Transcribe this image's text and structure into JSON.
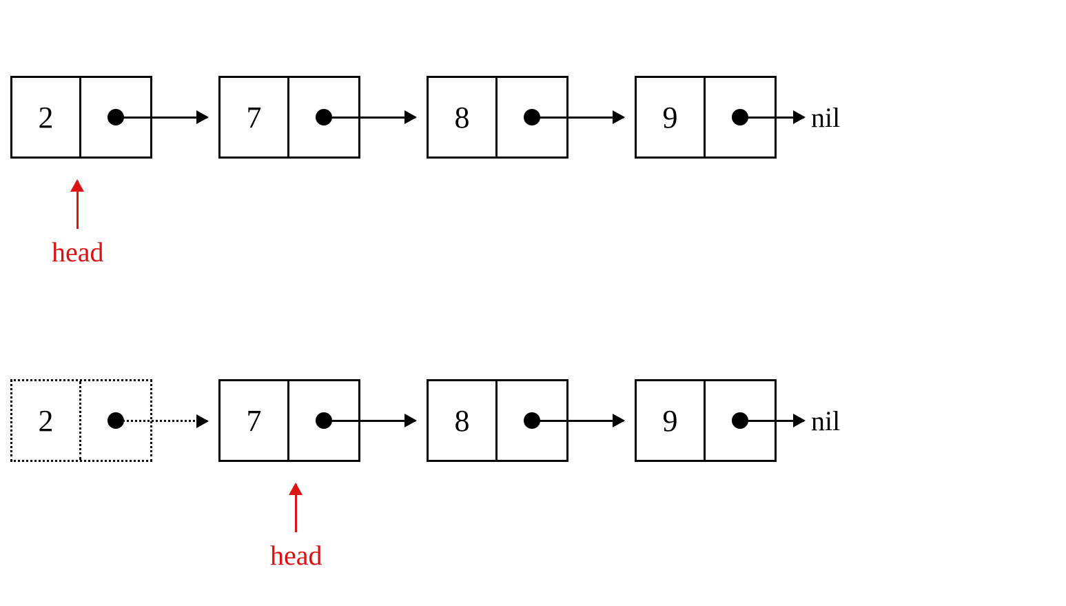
{
  "row1": {
    "nodes": [
      "2",
      "7",
      "8",
      "9"
    ],
    "terminator": "nil",
    "head_label": "head",
    "head_points_to_index": 0
  },
  "row2": {
    "nodes": [
      "2",
      "7",
      "8",
      "9"
    ],
    "terminator": "nil",
    "head_label": "head",
    "head_points_to_index": 1,
    "removed_index": 0
  }
}
